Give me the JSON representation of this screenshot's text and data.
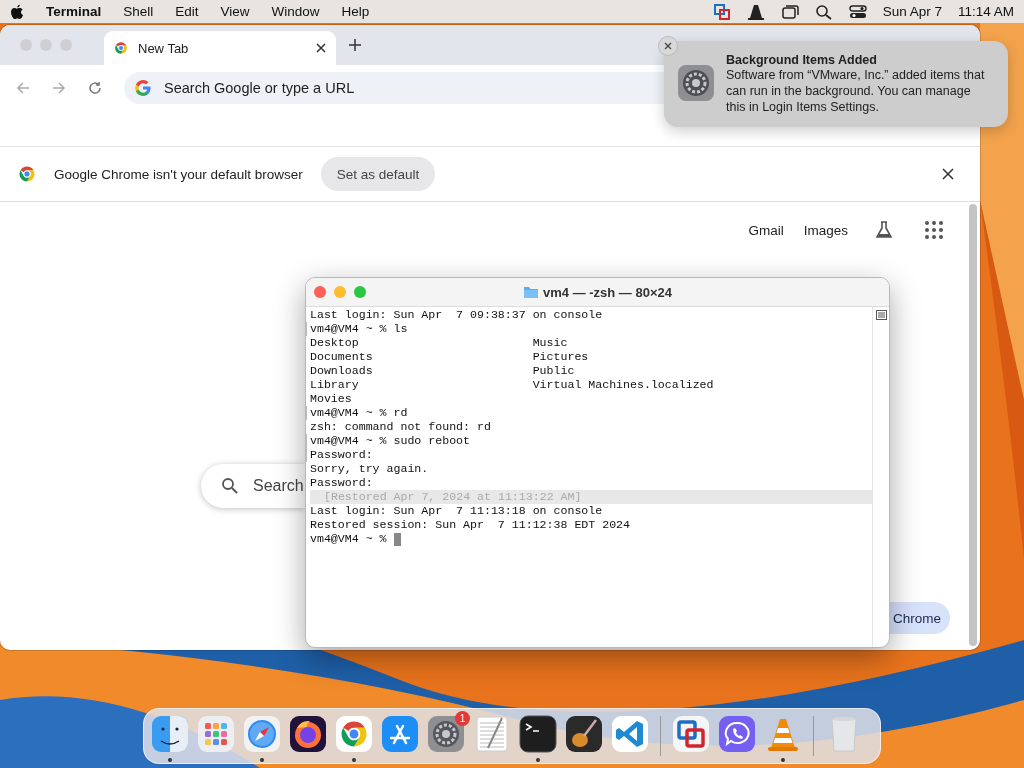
{
  "menu_bar": {
    "app": "Terminal",
    "items": [
      "Shell",
      "Edit",
      "View",
      "Window",
      "Help"
    ],
    "date": "Sun Apr 7",
    "time": "11:14 AM"
  },
  "browser": {
    "tabs": [
      {
        "title": "New Tab",
        "selected": true
      }
    ],
    "address_placeholder": "Search Google or type a URL",
    "infobar": {
      "message": "Google Chrome isn't your default browser",
      "button": "Set as default"
    },
    "page_links": [
      "Gmail",
      "Images"
    ],
    "search_box": {
      "placeholder": "Search"
    },
    "customize_button": "Chrome"
  },
  "terminal": {
    "title": "vm4 — -zsh — 80×24",
    "lines": [
      {
        "kind": "output",
        "text": "Last login: Sun Apr  7 09:38:37 on console"
      },
      {
        "kind": "prompt",
        "text": "vm4@VM4 ~ % ls"
      },
      {
        "kind": "output",
        "text": "Desktop                         Music"
      },
      {
        "kind": "output",
        "text": "Documents                       Pictures"
      },
      {
        "kind": "output",
        "text": "Downloads                       Public"
      },
      {
        "kind": "output",
        "text": "Library                         Virtual Machines.localized"
      },
      {
        "kind": "output",
        "text": "Movies"
      },
      {
        "kind": "prompt",
        "text": "vm4@VM4 ~ % rd"
      },
      {
        "kind": "output",
        "text": "zsh: command not found: rd"
      },
      {
        "kind": "prompt",
        "text": "vm4@VM4 ~ % sudo reboot"
      },
      {
        "kind": "prompt",
        "text": "Password:"
      },
      {
        "kind": "output",
        "text": "Sorry, try again."
      },
      {
        "kind": "output",
        "text": "Password:"
      },
      {
        "kind": "restored",
        "text": "[Restored Apr 7, 2024 at 11:13:22 AM]"
      },
      {
        "kind": "output",
        "text": "Last login: Sun Apr  7 11:13:18 on console"
      },
      {
        "kind": "output",
        "text": "Restored session: Sun Apr  7 11:12:38 EDT 2024"
      },
      {
        "kind": "cursor",
        "text": "vm4@VM4 ~ % "
      }
    ]
  },
  "notification": {
    "title": "Background Items Added",
    "body": "Software from “VMware, Inc.” added items that can run in the background. You can manage this in Login Items Settings."
  },
  "dock": [
    {
      "kind": "finder",
      "running": true
    },
    {
      "kind": "launchpad",
      "running": false
    },
    {
      "kind": "safari",
      "running": true
    },
    {
      "kind": "firefox",
      "running": false
    },
    {
      "kind": "chrome",
      "running": true
    },
    {
      "kind": "appstore",
      "running": false
    },
    {
      "kind": "settings",
      "running": false,
      "badge": "1"
    },
    {
      "kind": "textedit",
      "running": false
    },
    {
      "kind": "terminal",
      "running": true
    },
    {
      "kind": "garageband",
      "running": false
    },
    {
      "kind": "vscode",
      "running": false
    },
    {
      "kind": "divider"
    },
    {
      "kind": "vmware",
      "running": false
    },
    {
      "kind": "viber",
      "running": false
    },
    {
      "kind": "vlc",
      "running": true
    },
    {
      "kind": "divider"
    },
    {
      "kind": "trash",
      "running": false
    }
  ]
}
